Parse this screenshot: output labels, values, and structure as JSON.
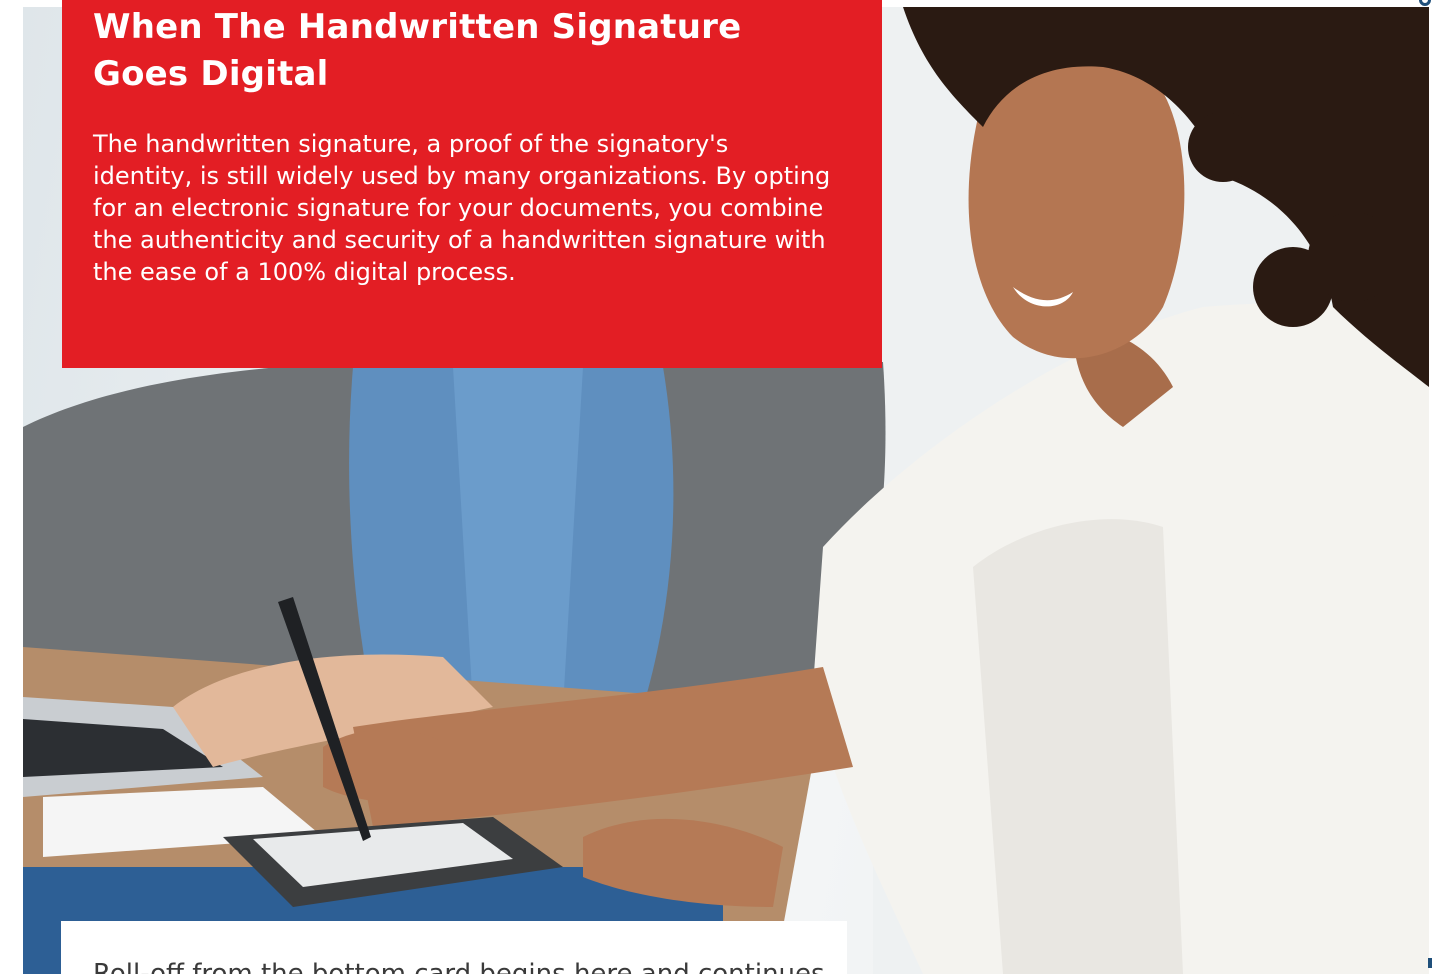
{
  "card": {
    "title": "When The Handwritten Signature Goes Digital",
    "body": "The handwritten signature, a proof of the signatory's identity, is still widely used by many organizations. By opting for an electronic signature for your documents, you combine the authenticity and security of a handwritten signature with the ease of a 100% digital process."
  },
  "bottom_card": {
    "text": "Roll-off from the bottom card begins here and continues"
  },
  "photo": {
    "description_icon": "photo-woman-signing-on-signature-pad"
  },
  "colors": {
    "accent_red": "#e31e24",
    "mark_blue": "#1f4f7a"
  }
}
